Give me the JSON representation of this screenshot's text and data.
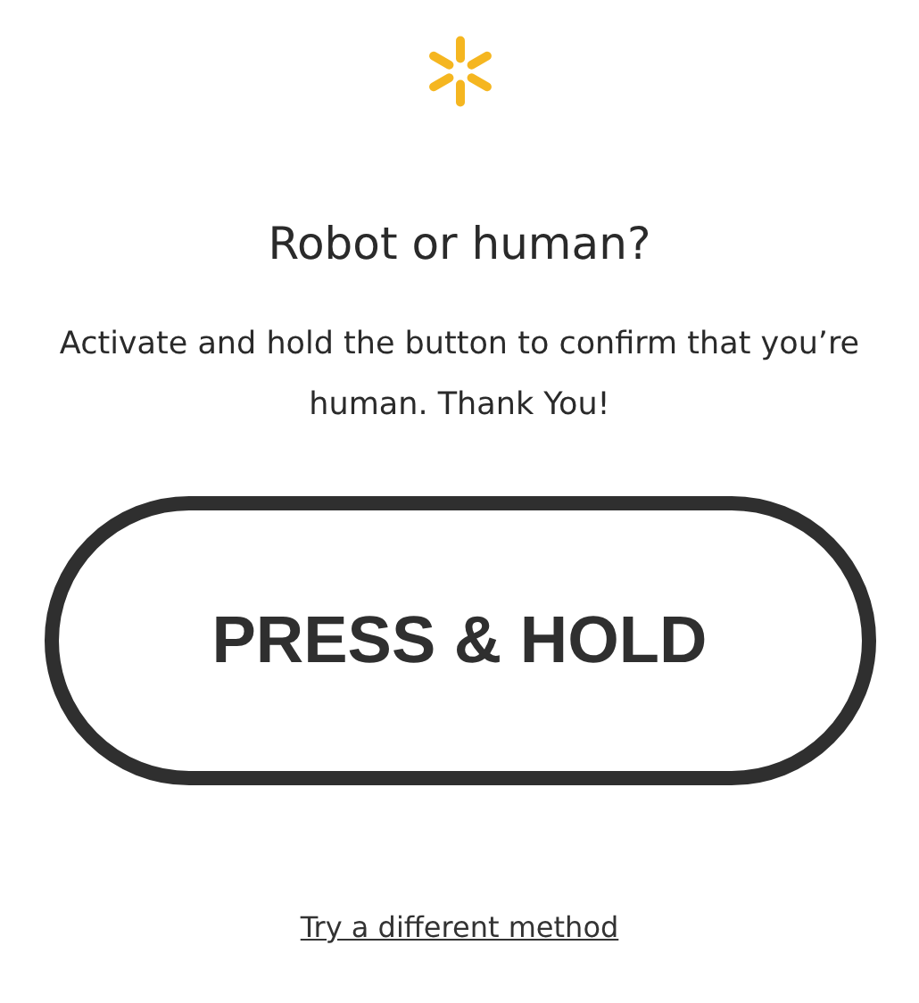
{
  "title": "Robot or human?",
  "message": "Activate and hold the button to confirm that you’re human. Thank You!",
  "hold_button": {
    "label": "PRESS & HOLD"
  },
  "alternative_link": "Try a different method"
}
